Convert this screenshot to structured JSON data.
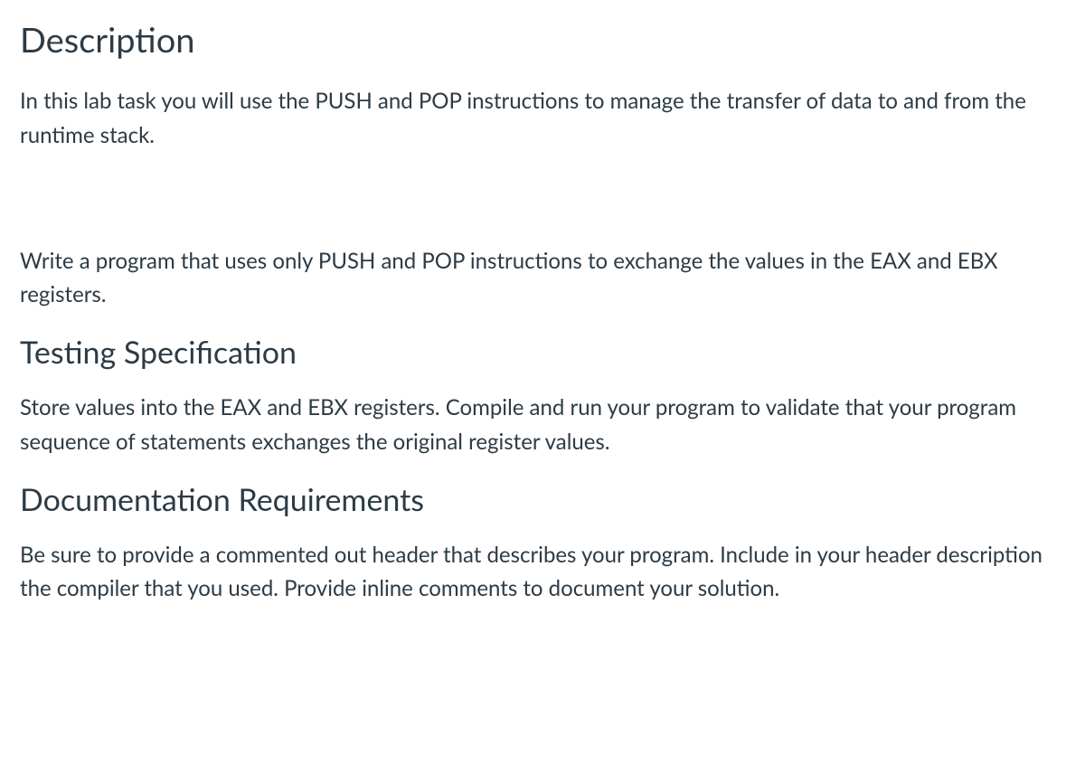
{
  "sections": {
    "description": {
      "heading": "Description",
      "intro": "In this lab task you will use the PUSH and POP instructions to manage the transfer of data to and from the runtime stack.",
      "task": "Write a program that uses only PUSH and POP instructions to exchange the values in the EAX and EBX registers."
    },
    "testing": {
      "heading": "Testing Specification",
      "body": "Store values into the EAX and EBX registers. Compile and run your program to validate that your program sequence of statements exchanges the original register values."
    },
    "documentation": {
      "heading": "Documentation Requirements",
      "body": "Be sure to provide a commented out header that describes your program. Include in your header description the compiler that you used.  Provide inline comments to document your solution."
    }
  }
}
